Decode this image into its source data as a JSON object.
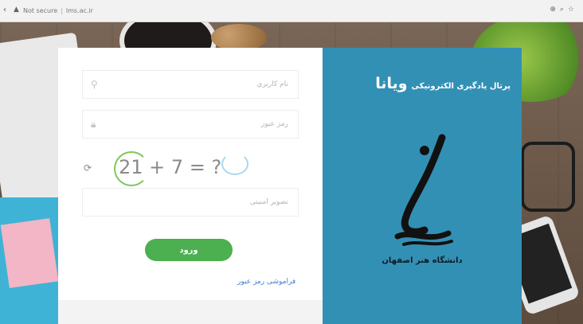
{
  "browser": {
    "back_glyph": "‹",
    "security_label": "Not secure",
    "url": "lms.ac.ir",
    "tool_icons": [
      "zoom-icon",
      "search-icon",
      "star-icon"
    ]
  },
  "login": {
    "username_placeholder": "نام کاربری",
    "password_placeholder": "رمز عبور",
    "captcha_question": "21 + 7 = ?",
    "captcha_placeholder": "تصویر امنیتی",
    "login_button": "ورود",
    "forgot_password": "فراموشی رمز عبور"
  },
  "brand": {
    "portal_prefix": "پرتال یادگیری الکترونیکی",
    "portal_name": "ویانا",
    "university": "دانشگاه هنر اصفهان"
  },
  "colors": {
    "brand_panel": "#3390b5",
    "login_button": "#4caf50",
    "link": "#3a7fd5"
  }
}
